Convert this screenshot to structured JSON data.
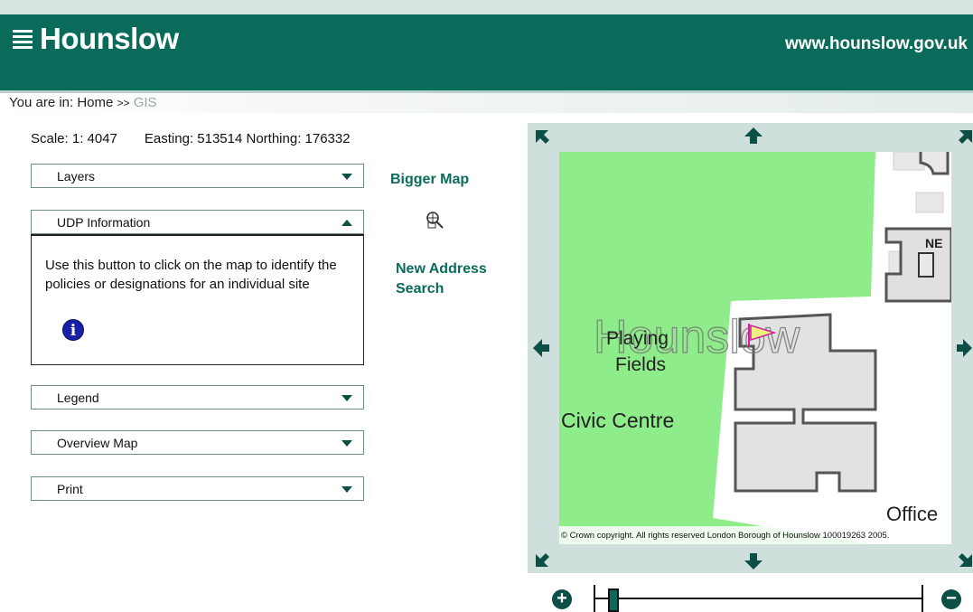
{
  "header": {
    "logo_text": "Hounslow",
    "url": "www.hounslow.gov.uk"
  },
  "breadcrumb": {
    "prefix": "You are in:",
    "home": "Home",
    "separator": ">>",
    "current": "GIS"
  },
  "map_info": {
    "scale": "Scale: 1: 4047",
    "coords": "Easting: 513514 Northing: 176332"
  },
  "panels": {
    "layers": "Layers",
    "udp": "UDP Information",
    "udp_text": "Use this button to click on the map to identify the policies or designations for an individual site",
    "legend": "Legend",
    "overview": "Overview Map",
    "print": "Print"
  },
  "links": {
    "bigger_map": "Bigger Map",
    "new_address_line1": "New Address",
    "new_address_line2": "Search"
  },
  "map": {
    "watermark": "Hounslow",
    "label_playing_1": "Playing",
    "label_playing_2": "Fields",
    "label_civic": "Civic Centre",
    "label_office": "Office",
    "label_ne": "NE",
    "copyright": "© Crown copyright. All rights reserved London Borough of Hounslow 100019263 2005."
  },
  "zoom": {
    "in_symbol": "+",
    "out_symbol": "−",
    "level_fraction": 0.03
  },
  "colors": {
    "brand": "#0b6b5b",
    "frame": "#cfdfdc",
    "park": "#8fec8a",
    "building": "#e8e8e8"
  }
}
